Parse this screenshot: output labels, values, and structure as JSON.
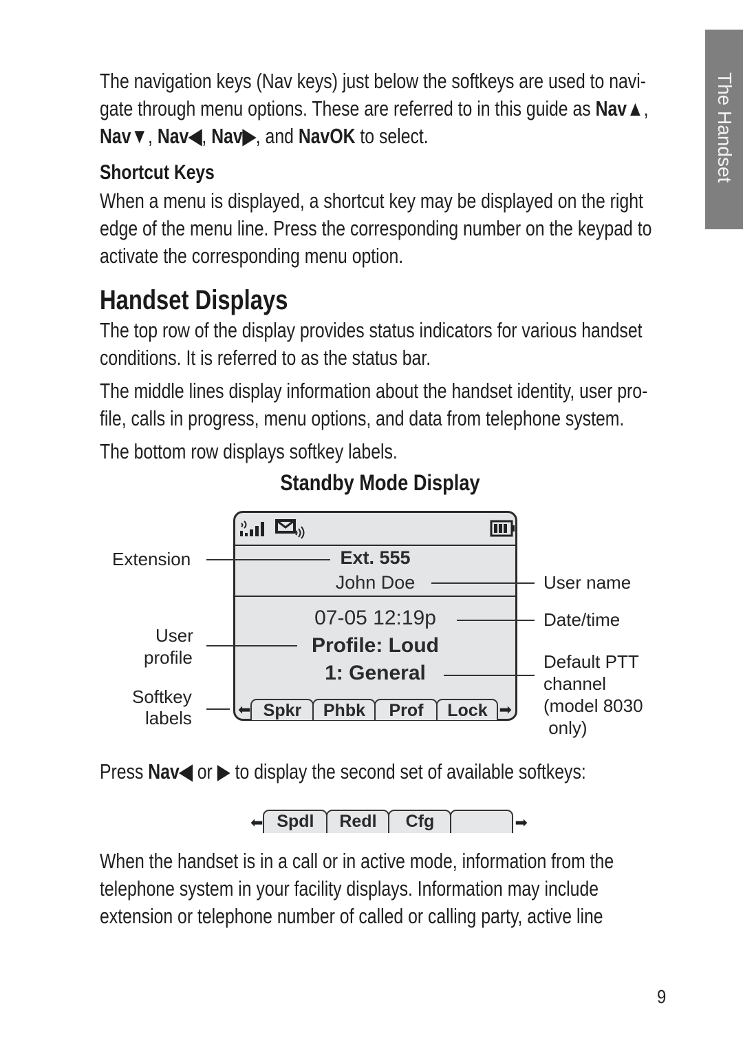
{
  "side_tab": {
    "label": "The Handset",
    "color": "#7f7f7f"
  },
  "intro": {
    "line1": "The navigation keys (Nav keys) just below the softkeys are used to navi-",
    "line2_a": "gate through menu options. These are referred to in this guide as ",
    "nav_up": "Nav▲",
    "line2_b": ",",
    "nav_down": "Nav▼",
    "sep1": ", ",
    "nav_left": "Nav◀",
    "sep2": ", ",
    "nav_right": "Nav▶",
    "sep3": ", and ",
    "nav_ok": "NavOK",
    "line3_end": " to select."
  },
  "shortcut": {
    "heading": "Shortcut Keys",
    "lines": [
      "When a menu is displayed, a shortcut key may be displayed on the right",
      "edge of the menu line. Press the corresponding number on the keypad to",
      "activate the corresponding menu option."
    ]
  },
  "handset_displays": {
    "heading": "Handset Displays",
    "p1": [
      "The top row of the display provides status indicators for various handset",
      "conditions. It is referred to as the status bar."
    ],
    "p2": [
      "The middle lines display information about the handset identity, user pro-",
      "file, calls in progress, menu options, and data from telephone system."
    ],
    "p3": "The bottom row displays softkey labels."
  },
  "figure": {
    "title": "Standby Mode Display",
    "icons": [
      "signal-strength-icon",
      "message-waiting-icon",
      "battery-icon"
    ],
    "extension": "Ext. 555",
    "user_name": "John Doe",
    "date_time": "07-05  12:19p",
    "profile": "Profile: Loud",
    "ptt_channel": "1: General",
    "softkeys": [
      "Spkr",
      "Phbk",
      "Prof",
      "Lock"
    ],
    "callouts_left": {
      "extension": "Extension",
      "user_profile_1": "User",
      "user_profile_2": "profile",
      "softkey_1": "Softkey",
      "softkey_2": "labels"
    },
    "callouts_right": {
      "user_name": "User name",
      "date_time": "Date/time",
      "ptt_1": "Default PTT",
      "ptt_2": "channel",
      "ptt_3": "(model 8030",
      "ptt_4": " only)"
    }
  },
  "press_line": {
    "a": "Press ",
    "nav_left": "Nav◀",
    "b": " or ",
    "right": "▶",
    "c": " to display the second set of available softkeys:"
  },
  "second_softkeys": [
    "Spdl",
    "Redl",
    "Cfg",
    ""
  ],
  "active_mode": [
    "When the handset is in a call or in active mode, information from the",
    "telephone system in your facility displays. Information may include",
    "extension or telephone number of called or calling party, active line"
  ],
  "page_number": "9"
}
